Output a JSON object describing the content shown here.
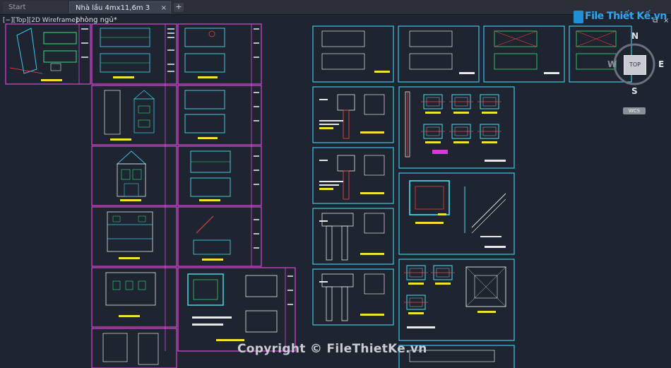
{
  "tabs": [
    {
      "label": "Start"
    },
    {
      "label": "Nhà lầu 4mx11,6m 3 phòng ngủ*",
      "close": "×"
    }
  ],
  "new_tab": "+",
  "viewport": {
    "label": "[−][Top][2D Wireframe]"
  },
  "window_controls": {
    "restore": "⧉",
    "close": "×"
  },
  "logo": {
    "text": "File Thiết Kế.vn"
  },
  "viewcube": {
    "north": "N",
    "east": "E",
    "south": "S",
    "west": "W",
    "face": "TOP"
  },
  "wcs": {
    "label": "WCS"
  },
  "watermark": {
    "text": "Copyright © FileThietKe.vn"
  },
  "colors": {
    "canvas": "#1e2430",
    "sheet_magenta": "#d84ad8",
    "sheet_cyan": "#3ec8e8",
    "wall_cyan": "#46e0f0",
    "note_yellow": "#f2e22a",
    "mark_red": "#ff4040",
    "mark_green": "#39e07a"
  }
}
